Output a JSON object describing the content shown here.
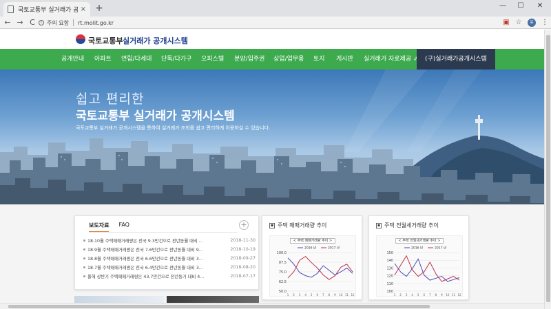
{
  "browser": {
    "tab_title": "국토교통부 실거래가 공개시스템",
    "tab_close": "×",
    "new_tab": "+",
    "win_min": "—",
    "win_max": "☐",
    "win_close": "✕",
    "back": "←",
    "forward": "→",
    "reload": "C",
    "security_label": "주의 요함",
    "url": "rt.molit.go.kr",
    "avatar_text": "유",
    "menu": "⋮",
    "star": "☆"
  },
  "header": {
    "org": "국토교통부",
    "system": "실거래가 공개시스템"
  },
  "nav": {
    "items": [
      "공개안내",
      "아파트",
      "연립/다세대",
      "단독/다가구",
      "오피스텔",
      "분양/입주권",
      "상업/업무용",
      "토지",
      "게시판",
      "실거래가 자료제공 ⇗",
      "(구)실거래가공개시스템"
    ]
  },
  "hero": {
    "subtitle": "쉽고 편리한",
    "title": "국토교통부 실거래가 공개시스템",
    "desc": "국토교통부 실거래가 공개시스템을 통하여 실거래가 조회를 쉽고 편리하게 이용하실 수 있습니다."
  },
  "news": {
    "tab_press": "보도자료",
    "tab_faq": "FAQ",
    "more": "+",
    "rows": [
      {
        "title": "18.10월 주택매매거래량은 전국 9.3만건으로 전년동월 대비 ...",
        "date": "2018-11-30"
      },
      {
        "title": "18.9월 주택매매거래량은 전국 7.6만건으로 전년동월 대비 9...",
        "date": "2018-10-19"
      },
      {
        "title": "18.8월 주택매매거래량은 전국 6.6만건으로 전년동월 대비 3...",
        "date": "2018-09-27"
      },
      {
        "title": "18.7월 주택매매거래량은 전국 6.4만건으로 전년동월 대비 3...",
        "date": "2018-08-20"
      },
      {
        "title": "올해 상반기 주택매매거래량은 43.7만건으로 전년동기 대비 4...",
        "date": "2018-07-17"
      }
    ]
  },
  "charts": {
    "sales": {
      "heading": "주택 매매거래량 추이",
      "caption": "< 주택 매매거래량 추이 >"
    },
    "rent": {
      "heading": "주택 전월세거래량 추이",
      "caption": "< 주택 전월세거래량 추이 >"
    }
  },
  "chart_data": [
    {
      "type": "line",
      "title": "< 주택 매매거래량 추이 >",
      "series": [
        {
          "name": "2016 년",
          "color": "#4a4ab8",
          "values": [
            98,
            90,
            79,
            75,
            73,
            78,
            88,
            82,
            76,
            80,
            85,
            78
          ]
        },
        {
          "name": "2017 년",
          "color": "#c0304a",
          "values": [
            72,
            80,
            95,
            100,
            92,
            85,
            76,
            70,
            75,
            86,
            90,
            80
          ]
        }
      ],
      "ylim": [
        55,
        105
      ],
      "yticks": [
        "100.0",
        "87.5",
        "75.0",
        "62.5",
        "50.0"
      ],
      "x": [
        "1",
        "2",
        "3",
        "4",
        "5",
        "6",
        "7",
        "8",
        "9",
        "10",
        "11",
        "12"
      ]
    },
    {
      "type": "line",
      "title": "< 주택 전월세거래량 추이 >",
      "series": [
        {
          "name": "2016 년",
          "color": "#4a4ab8",
          "values": [
            138,
            125,
            118,
            130,
            145,
            120,
            112,
            115,
            118,
            110,
            113,
            116
          ]
        },
        {
          "name": "2017 년",
          "color": "#c0304a",
          "values": [
            120,
            135,
            150,
            128,
            118,
            125,
            140,
            122,
            110,
            114,
            118,
            112
          ]
        }
      ],
      "ylim": [
        95,
        155
      ],
      "yticks": [
        "150",
        "140",
        "130",
        "120",
        "110",
        "100"
      ],
      "x": [
        "1",
        "2",
        "3",
        "4",
        "5",
        "6",
        "7",
        "8",
        "9",
        "10",
        "11",
        "12"
      ]
    }
  ],
  "colors": {
    "nav_green": "#3daa4e",
    "nav_dark": "#2b3a4e",
    "accent_orange": "#e07b2a"
  }
}
